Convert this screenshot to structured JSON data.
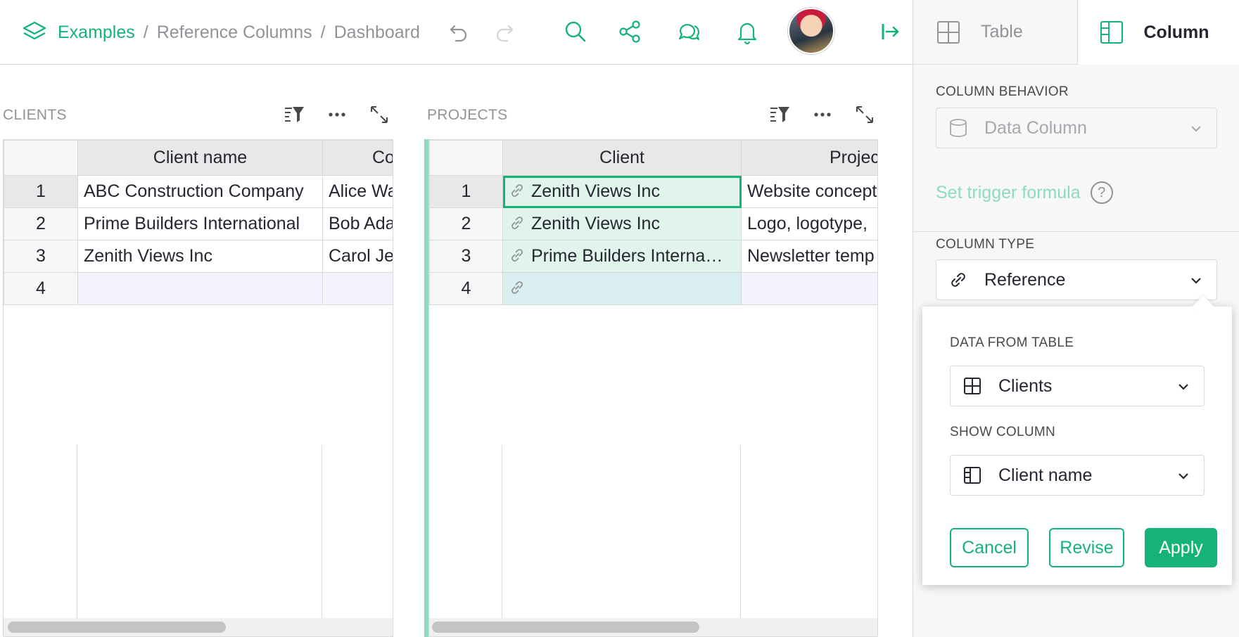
{
  "breadcrumb": {
    "home": "Examples",
    "separator": "/",
    "document": "Reference Columns",
    "page": "Dashboard"
  },
  "toolbar": {
    "icons": [
      "undo-icon",
      "redo-icon",
      "search-icon",
      "share-icon",
      "comments-icon",
      "notifications-icon",
      "account-avatar",
      "panel-toggle-icon"
    ]
  },
  "right_panel": {
    "tabs": {
      "table": "Table",
      "column": "Column"
    },
    "column_behavior": {
      "label": "COLUMN BEHAVIOR",
      "value": "Data Column"
    },
    "trigger_formula": {
      "label": "Set trigger formula",
      "help": "?"
    },
    "column_type": {
      "label": "COLUMN TYPE",
      "value": "Reference"
    },
    "popup": {
      "data_from_table": {
        "label": "DATA FROM TABLE",
        "value": "Clients"
      },
      "show_column": {
        "label": "SHOW COLUMN",
        "value": "Client name"
      },
      "buttons": {
        "cancel": "Cancel",
        "revise": "Revise",
        "apply": "Apply"
      }
    }
  },
  "clients": {
    "title": "CLIENTS",
    "columns": [
      "Client name",
      "Co"
    ],
    "rows": [
      {
        "n": "1",
        "c1": "ABC Construction Company",
        "c2": "Alice Wa"
      },
      {
        "n": "2",
        "c1": "Prime Builders International",
        "c2": "Bob Ada"
      },
      {
        "n": "3",
        "c1": "Zenith Views Inc",
        "c2": "Carol Je"
      },
      {
        "n": "4",
        "c1": "",
        "c2": ""
      }
    ]
  },
  "projects": {
    "title": "PROJECTS",
    "columns": [
      "Client",
      "Projec"
    ],
    "rows": [
      {
        "n": "1",
        "c1": "Zenith Views Inc",
        "c2": "Website concept"
      },
      {
        "n": "2",
        "c1": "Zenith Views Inc",
        "c2": "Logo, logotype,"
      },
      {
        "n": "3",
        "c1": "Prime Builders Interna…",
        "c2": "Newsletter temp"
      },
      {
        "n": "4",
        "c1": "",
        "c2": ""
      }
    ]
  },
  "colors": {
    "accent": "#16b378",
    "accent_light": "#8ddcbd",
    "reference_cell_bg": "#e0f4ec"
  }
}
